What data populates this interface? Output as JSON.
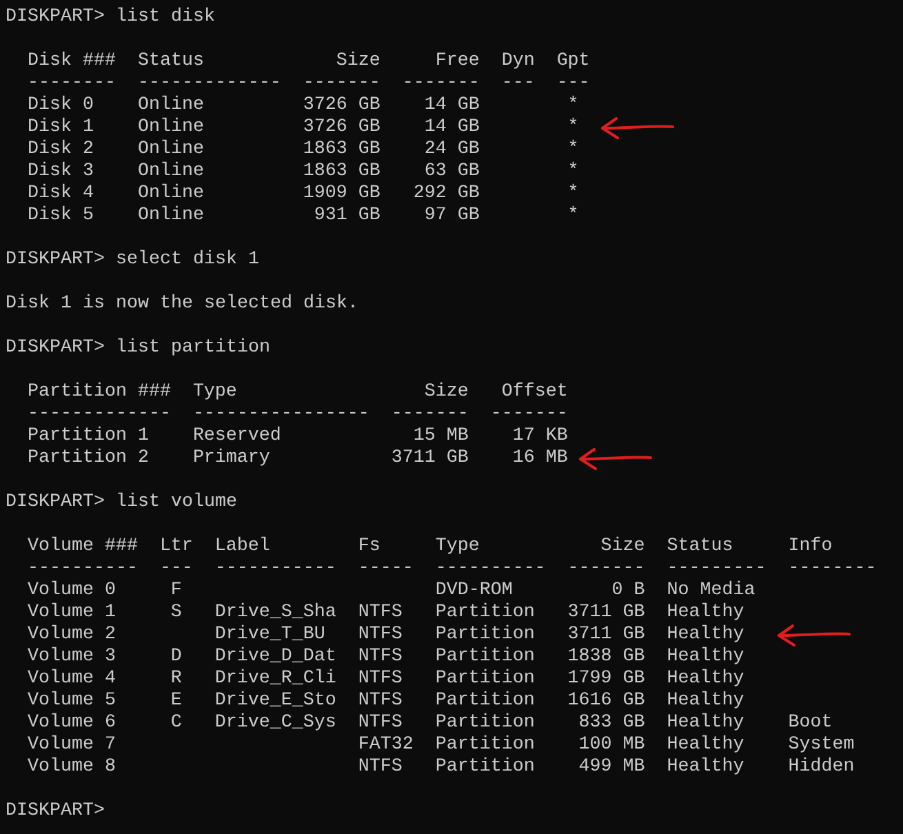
{
  "console": {
    "blocks": [
      {
        "kind": "command",
        "prompt": "DISKPART>",
        "text": "list disk"
      },
      {
        "kind": "table",
        "columns": [
          {
            "header": "Disk ###",
            "rule": "--------",
            "kind": "text"
          },
          {
            "header": "Status",
            "rule": "-------------",
            "kind": "text"
          },
          {
            "header": "Size",
            "rule": "-------",
            "kind": "number"
          },
          {
            "header": "Free",
            "rule": "-------",
            "kind": "number"
          },
          {
            "header": "Dyn",
            "rule": "---",
            "kind": "flag"
          },
          {
            "header": "Gpt",
            "rule": "---",
            "kind": "flag"
          }
        ],
        "rows": [
          {
            "cells": [
              "Disk 0",
              "Online",
              "3726 GB",
              "14 GB",
              null,
              "*"
            ],
            "marked": false
          },
          {
            "cells": [
              "Disk 1",
              "Online",
              "3726 GB",
              "14 GB",
              null,
              "*"
            ],
            "marked": true
          },
          {
            "cells": [
              "Disk 2",
              "Online",
              "1863 GB",
              "24 GB",
              null,
              "*"
            ],
            "marked": false
          },
          {
            "cells": [
              "Disk 3",
              "Online",
              "1863 GB",
              "63 GB",
              null,
              "*"
            ],
            "marked": false
          },
          {
            "cells": [
              "Disk 4",
              "Online",
              "1909 GB",
              "292 GB",
              null,
              "*"
            ],
            "marked": false
          },
          {
            "cells": [
              "Disk 5",
              "Online",
              "931 GB",
              "97 GB",
              null,
              "*"
            ],
            "marked": false
          }
        ]
      },
      {
        "kind": "command",
        "prompt": "DISKPART>",
        "text": "select disk 1"
      },
      {
        "kind": "message",
        "text": "Disk 1 is now the selected disk."
      },
      {
        "kind": "command",
        "prompt": "DISKPART>",
        "text": "list partition"
      },
      {
        "kind": "table",
        "columns": [
          {
            "header": "Partition ###",
            "rule": "-------------",
            "kind": "text"
          },
          {
            "header": "Type",
            "rule": "----------------",
            "kind": "text"
          },
          {
            "header": "Size",
            "rule": "-------",
            "kind": "number"
          },
          {
            "header": "Offset",
            "rule": "-------",
            "kind": "number"
          }
        ],
        "rows": [
          {
            "cells": [
              "Partition 1",
              "Reserved",
              "15 MB",
              "17 KB"
            ],
            "marked": false
          },
          {
            "cells": [
              "Partition 2",
              "Primary",
              "3711 GB",
              "16 MB"
            ],
            "marked": true
          }
        ]
      },
      {
        "kind": "command",
        "prompt": "DISKPART>",
        "text": "list volume"
      },
      {
        "kind": "table",
        "columns": [
          {
            "header": "Volume ###",
            "rule": "----------",
            "kind": "text"
          },
          {
            "header": "Ltr",
            "rule": "---",
            "kind": "flag"
          },
          {
            "header": "Label",
            "rule": "-----------",
            "kind": "text"
          },
          {
            "header": "Fs",
            "rule": "-----",
            "kind": "text"
          },
          {
            "header": "Type",
            "rule": "----------",
            "kind": "text"
          },
          {
            "header": "Size",
            "rule": "-------",
            "kind": "number"
          },
          {
            "header": "Status",
            "rule": "---------",
            "kind": "text"
          },
          {
            "header": "Info",
            "rule": "--------",
            "kind": "text"
          }
        ],
        "rows": [
          {
            "cells": [
              "Volume 0",
              "F",
              null,
              null,
              "DVD-ROM",
              "0 B",
              "No Media",
              null
            ],
            "marked": false
          },
          {
            "cells": [
              "Volume 1",
              "S",
              "Drive_S_Sha",
              "NTFS",
              "Partition",
              "3711 GB",
              "Healthy",
              null
            ],
            "marked": false
          },
          {
            "cells": [
              "Volume 2",
              null,
              "Drive_T_BU",
              "NTFS",
              "Partition",
              "3711 GB",
              "Healthy",
              null
            ],
            "marked": true
          },
          {
            "cells": [
              "Volume 3",
              "D",
              "Drive_D_Dat",
              "NTFS",
              "Partition",
              "1838 GB",
              "Healthy",
              null
            ],
            "marked": false
          },
          {
            "cells": [
              "Volume 4",
              "R",
              "Drive_R_Cli",
              "NTFS",
              "Partition",
              "1799 GB",
              "Healthy",
              null
            ],
            "marked": false
          },
          {
            "cells": [
              "Volume 5",
              "E",
              "Drive_E_Sto",
              "NTFS",
              "Partition",
              "1616 GB",
              "Healthy",
              null
            ],
            "marked": false
          },
          {
            "cells": [
              "Volume 6",
              "C",
              "Drive_C_Sys",
              "NTFS",
              "Partition",
              "833 GB",
              "Healthy",
              "Boot"
            ],
            "marked": false
          },
          {
            "cells": [
              "Volume 7",
              null,
              null,
              "FAT32",
              "Partition",
              "100 MB",
              "Healthy",
              "System"
            ],
            "marked": false
          },
          {
            "cells": [
              "Volume 8",
              null,
              null,
              "NTFS",
              "Partition",
              "499 MB",
              "Healthy",
              "Hidden"
            ],
            "marked": false
          }
        ]
      },
      {
        "kind": "prompt",
        "prompt": "DISKPART>"
      }
    ]
  }
}
